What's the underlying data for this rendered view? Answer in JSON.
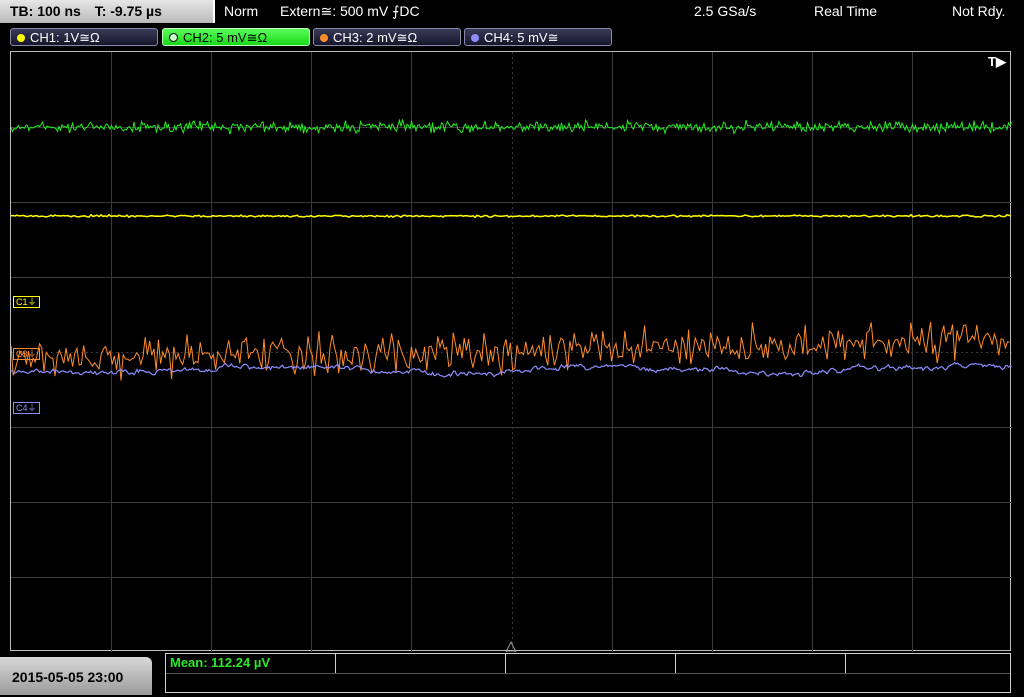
{
  "topbar": {
    "timebase": "TB: 100 ns",
    "trigger_time": "T: -9.75 µs",
    "mode": "Norm",
    "trigger_source": "Extern≅: 500 mV ⨍DC",
    "sample_rate": "2.5 GSa/s",
    "acquisition": "Real Time",
    "status": "Not Rdy."
  },
  "channels": [
    {
      "label": "CH1: 1V≅Ω",
      "color": "#ffff00"
    },
    {
      "label": "CH2: 5 mV≅Ω",
      "color": "#22ee22"
    },
    {
      "label": "CH3: 2 mV≅Ω",
      "color": "#ff8c2a"
    },
    {
      "label": "CH4: 5 mV≅",
      "color": "#8c8cff"
    }
  ],
  "markers": {
    "trigger_pos": "T▶",
    "c1": "C1⏚",
    "c3": "C3⏚",
    "c4": "C4⏚"
  },
  "footer": {
    "datetime": "2015-05-05 23:00",
    "mean": "Mean: 112.24 µV"
  }
}
